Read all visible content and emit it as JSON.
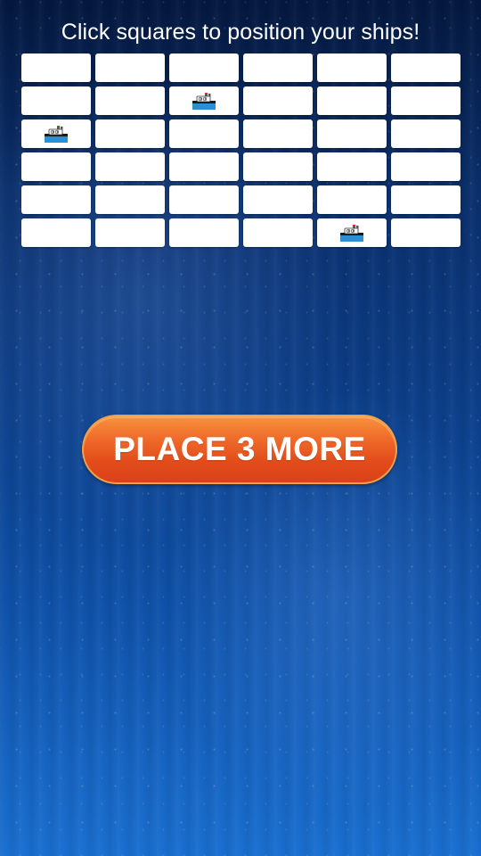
{
  "header": {
    "instruction": "Click squares to position your ships!"
  },
  "board": {
    "rows": 6,
    "cols": 6,
    "cells": [
      [
        "",
        "",
        "",
        "",
        "",
        ""
      ],
      [
        "",
        "",
        "ship",
        "",
        "",
        ""
      ],
      [
        "ship",
        "",
        "",
        "",
        "",
        ""
      ],
      [
        "",
        "",
        "",
        "",
        "",
        ""
      ],
      [
        "",
        "",
        "",
        "",
        "",
        ""
      ],
      [
        "",
        "",
        "",
        "",
        "ship",
        ""
      ]
    ],
    "ship_icon": "ship-icon",
    "cell_color": "#ffffff",
    "ship_hull_color": "#2b8fd6"
  },
  "action": {
    "place_label": "PLACE 3 MORE",
    "button_color": "#e95a22"
  }
}
